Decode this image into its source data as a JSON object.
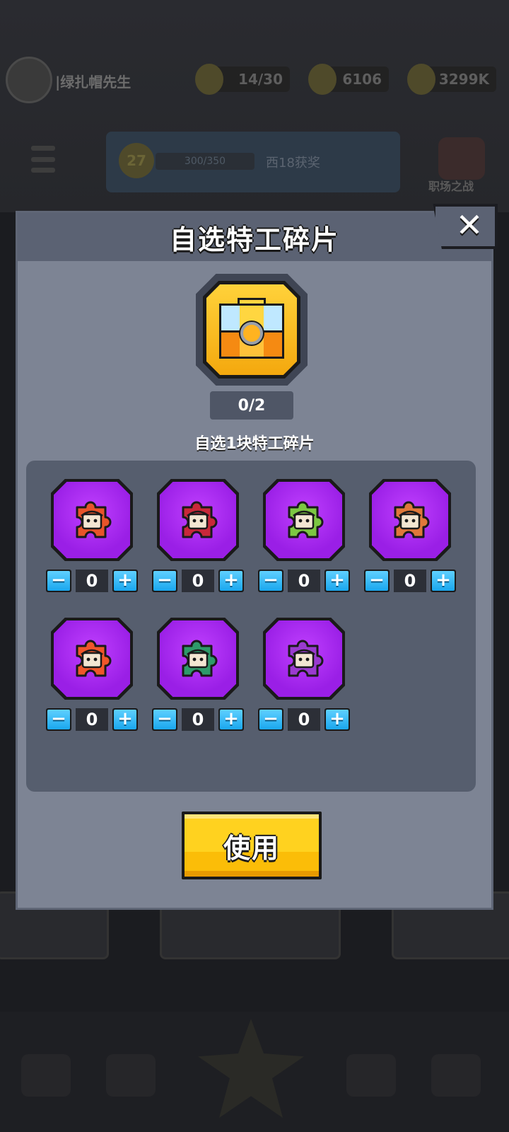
{
  "background": {
    "player_name": "|绿扎帽先生",
    "energy": "14/30",
    "gems": "6106",
    "coins": "3299K",
    "level": "27",
    "xp": "300/350",
    "banner_text": "西18获奖",
    "right_label": "职场之战"
  },
  "modal": {
    "title": "自选特工碎片",
    "close_label": "✕",
    "progress": "0/2",
    "subtitle": "自选1块特工碎片",
    "fragments": [
      {
        "accent": "#e8542a",
        "count": "0",
        "minus": "−",
        "plus": "+"
      },
      {
        "accent": "#c8283a",
        "count": "0",
        "minus": "−",
        "plus": "+"
      },
      {
        "accent": "#7cc742",
        "count": "0",
        "minus": "−",
        "plus": "+"
      },
      {
        "accent": "#e0783a",
        "count": "0",
        "minus": "−",
        "plus": "+"
      },
      {
        "accent": "#f0562a",
        "count": "0",
        "minus": "−",
        "plus": "+"
      },
      {
        "accent": "#2e9a6a",
        "count": "0",
        "minus": "−",
        "plus": "+"
      },
      {
        "accent": "#9a3ad0",
        "count": "0",
        "minus": "−",
        "plus": "+"
      }
    ],
    "use_label": "使用"
  },
  "colors": {
    "modal_bg": "#7d8494",
    "header_bg": "#5b6273",
    "panel_bg": "#565e6e",
    "tile_purple": "#a526ee",
    "button_yellow": "#fcc810",
    "stepper_blue": "#1aa7ee"
  }
}
